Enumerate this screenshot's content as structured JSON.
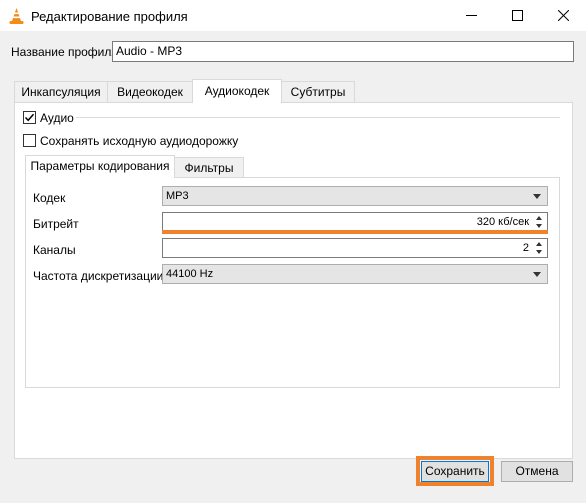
{
  "window": {
    "title": "Редактирование профиля"
  },
  "profile": {
    "name_label": "Название профиля",
    "name_value": "Audio - MP3"
  },
  "tabs": [
    {
      "label": "Инкапсуляция"
    },
    {
      "label": "Видеокодек"
    },
    {
      "label": "Аудиокодек"
    },
    {
      "label": "Субтитры"
    }
  ],
  "audio": {
    "enabled_label": "Аудио",
    "enabled": true,
    "keep_original_label": "Сохранять исходную аудиодорожку",
    "keep_original": false
  },
  "subtabs": [
    {
      "label": "Параметры кодирования"
    },
    {
      "label": "Фильтры"
    }
  ],
  "encoding": {
    "codec_label": "Кодек",
    "codec_value": "MP3",
    "bitrate_label": "Битрейт",
    "bitrate_value": "320 кб/сек",
    "channels_label": "Каналы",
    "channels_value": "2",
    "samplerate_label": "Частота дискретизации",
    "samplerate_value": "44100 Hz"
  },
  "buttons": {
    "save": "Сохранить",
    "cancel": "Отмена"
  },
  "colors": {
    "highlight": "#f0822d",
    "title_bar": "#ffffff",
    "background": "#f0f0f0"
  },
  "icons": {
    "app": "vlc-cone-icon",
    "minimize": "minimize-icon",
    "maximize": "maximize-icon",
    "close": "close-icon"
  }
}
